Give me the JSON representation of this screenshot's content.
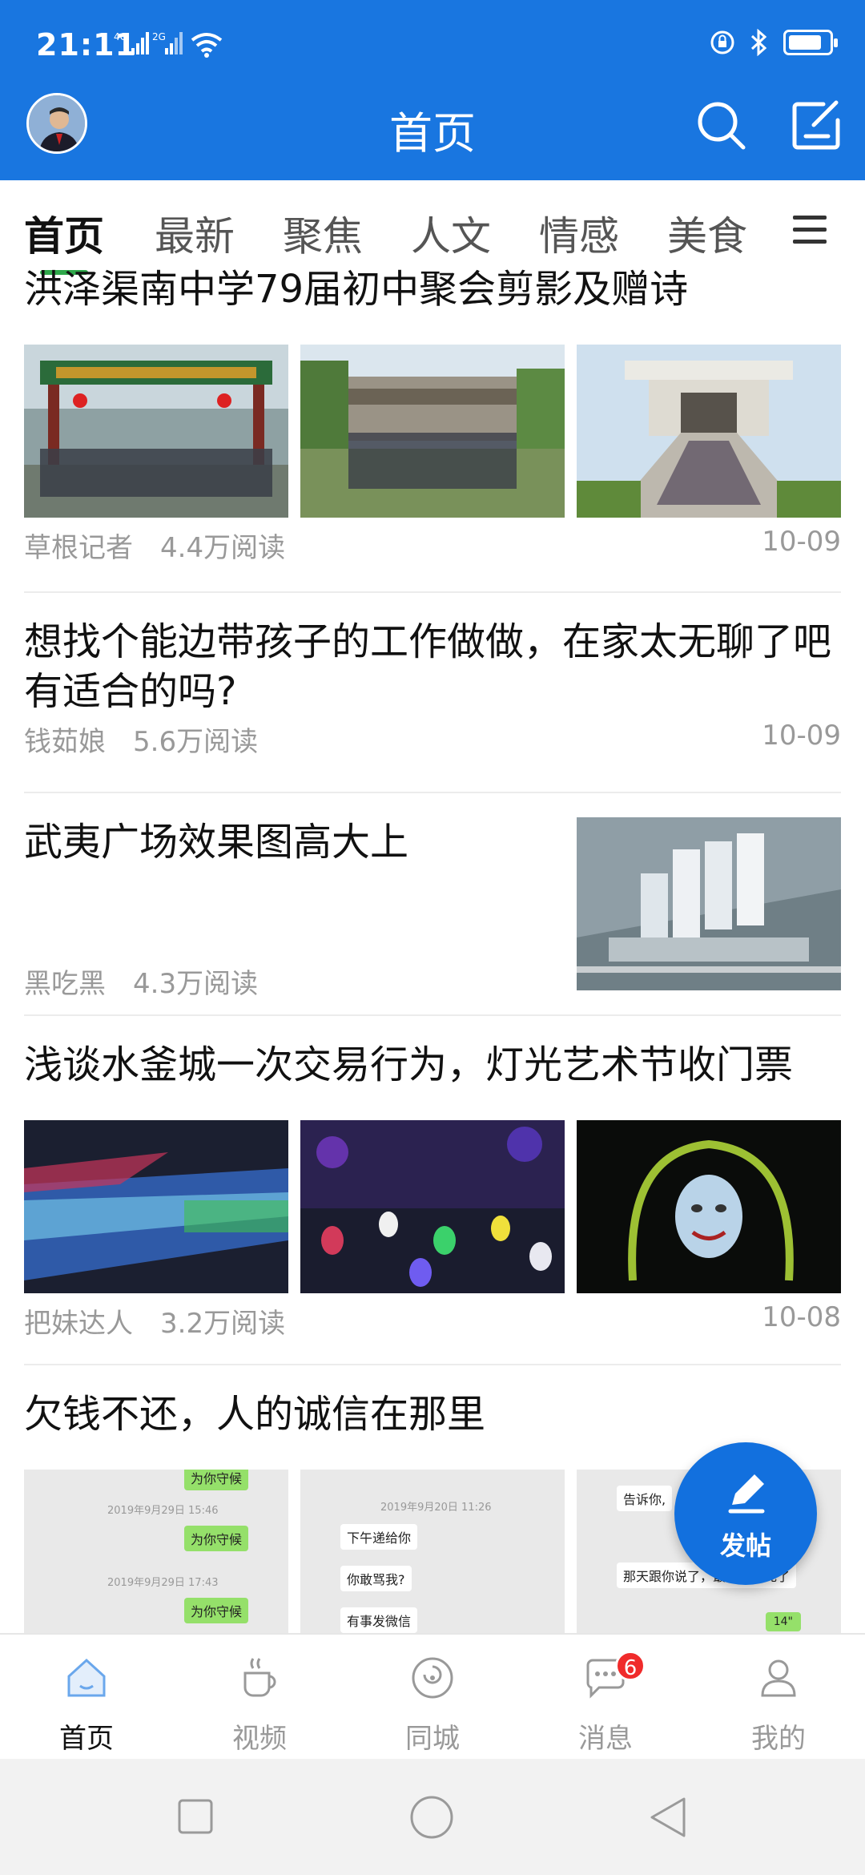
{
  "status_bar": {
    "time": "21:11",
    "net_1": "4G",
    "net_2": "2G",
    "battery_level": 0.75
  },
  "app_bar": {
    "title": "首页"
  },
  "tabs": {
    "items": [
      {
        "label": "首页",
        "active": true
      },
      {
        "label": "最新"
      },
      {
        "label": "聚焦"
      },
      {
        "label": "人文"
      },
      {
        "label": "情感"
      },
      {
        "label": "美食"
      }
    ]
  },
  "feed": {
    "posts": [
      {
        "title": "洪泽渠南中学79届初中聚会剪影及赠诗",
        "author": "草根记者",
        "reads": "4.4万阅读",
        "date": "10-09",
        "images": [
          "gate-group-photo",
          "courtyard-group-photo",
          "memorial-steps-photo"
        ]
      },
      {
        "title": "想找个能边带孩子的工作做做，在家太无聊了吧有适合的吗?",
        "author": "钱茹娘",
        "reads": "5.6万阅读",
        "date": "10-09"
      },
      {
        "title": "武夷广场效果图高大上",
        "author": "黑吃黑",
        "reads": "4.3万阅读",
        "image": "building-rendering"
      },
      {
        "title": "浅谈水釜城一次交易行为，灯光艺术节收门票",
        "author": "把妹达人",
        "reads": "3.2万阅读",
        "date": "10-08",
        "images": [
          "light-show-tunnel",
          "lantern-garden",
          "mask-light-art"
        ]
      },
      {
        "title": "欠钱不还，人的诚信在那里",
        "chat_1": {
          "t1": "2019年9月29日 15:46",
          "t2": "2019年9月29日 17:43",
          "m": "为你守候"
        },
        "chat_2": {
          "t1": "2019年9月20日 11:26",
          "m1": "下午递给你",
          "m2": "你敢骂我?",
          "m3": "有事发微信"
        },
        "chat_3": {
          "m1": "告诉你,",
          "m2": "那天跟你说了，最近困难死了",
          "m3": "14\""
        }
      }
    ]
  },
  "fab": {
    "label": "发帖",
    "icon": "pencil-icon"
  },
  "bottom_nav": {
    "items": [
      {
        "label": "首页",
        "icon": "home-icon",
        "active": true
      },
      {
        "label": "视频",
        "icon": "coffee-cup-icon"
      },
      {
        "label": "同城",
        "icon": "target-icon"
      },
      {
        "label": "消息",
        "icon": "chat-bubble-icon",
        "badge": "6"
      },
      {
        "label": "我的",
        "icon": "person-icon"
      }
    ]
  },
  "colors": {
    "primary": "#1976e0",
    "fab": "#1270de",
    "tab_indicator": "#2ea84a",
    "badge": "#f02b2b"
  }
}
